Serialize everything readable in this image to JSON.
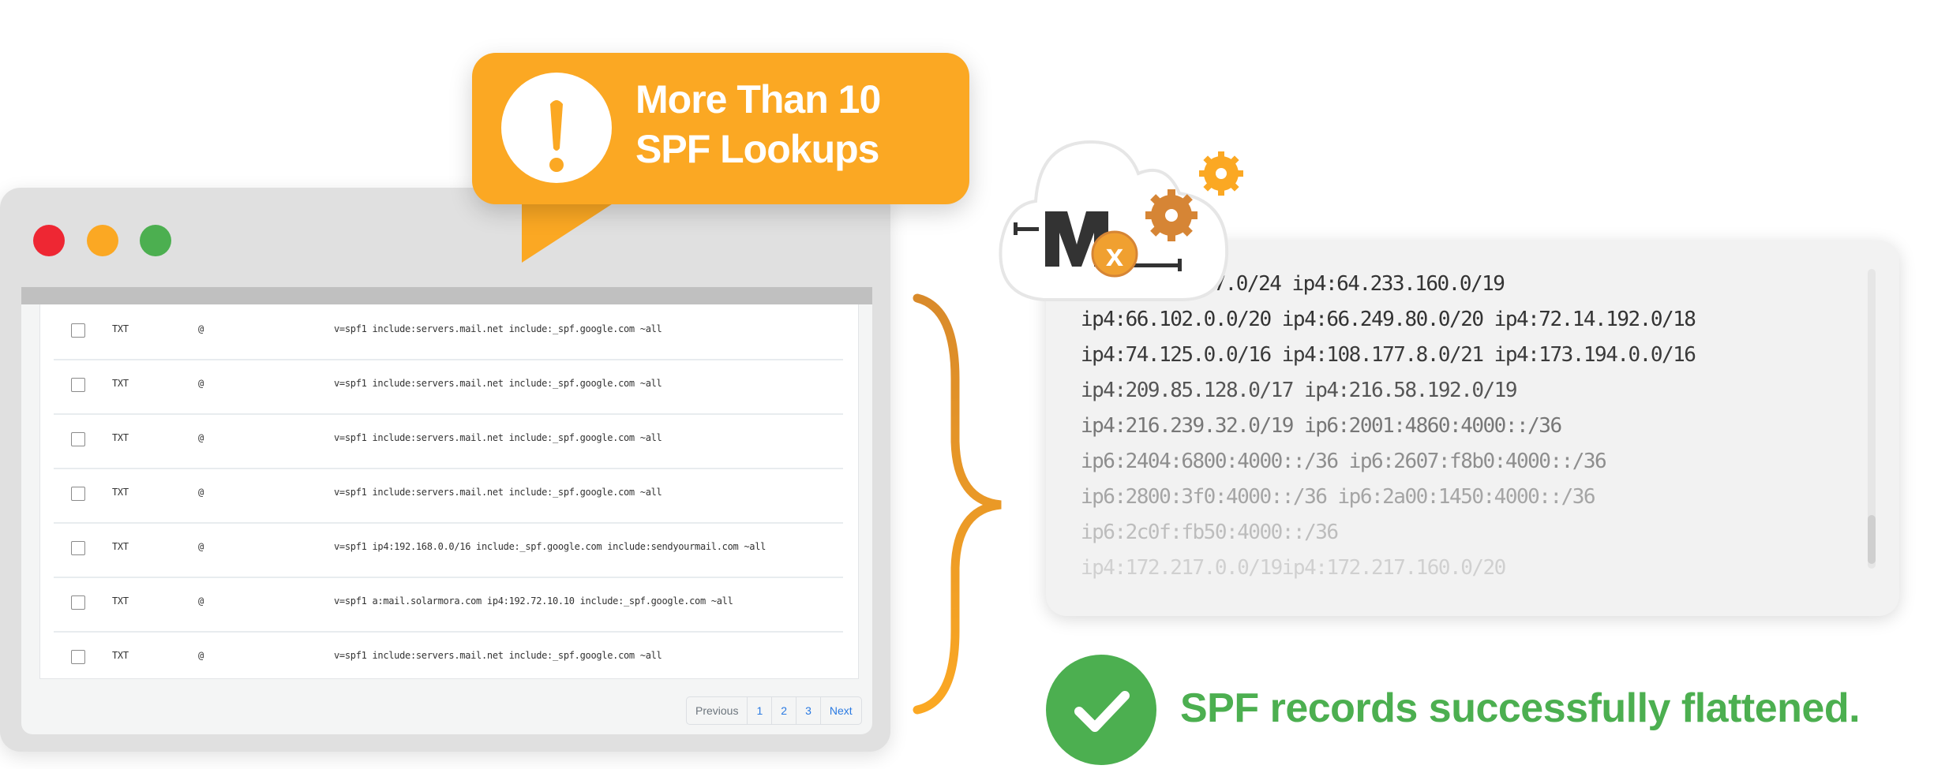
{
  "colors": {
    "accent_orange": "#fba823",
    "success_green": "#4caf50",
    "window_gray": "#e0e0e0",
    "link_blue": "#2a7ae2"
  },
  "window": {
    "traffic_lights": [
      "#ee2733",
      "#fba823",
      "#4caf50"
    ]
  },
  "records": [
    {
      "type": "TXT",
      "host": "@",
      "value": "v=spf1 include:servers.mail.net include:_spf.google.com ~all"
    },
    {
      "type": "TXT",
      "host": "@",
      "value": "v=spf1 include:servers.mail.net include:_spf.google.com ~all"
    },
    {
      "type": "TXT",
      "host": "@",
      "value": "v=spf1 include:servers.mail.net include:_spf.google.com ~all"
    },
    {
      "type": "TXT",
      "host": "@",
      "value": "v=spf1 include:servers.mail.net include:_spf.google.com ~all"
    },
    {
      "type": "TXT",
      "host": "@",
      "value": "v=spf1 ip4:192.168.0.0/16 include:_spf.google.com include:sendyourmail.com ~all"
    },
    {
      "type": "TXT",
      "host": "@",
      "value": "v=spf1 a:mail.solarmora.com ip4:192.72.10.10 include:_spf.google.com ~all"
    },
    {
      "type": "TXT",
      "host": "@",
      "value": "v=spf1 include:servers.mail.net include:_spf.google.com ~all"
    }
  ],
  "pagination": {
    "previous": "Previous",
    "pages": [
      "1",
      "2",
      "3"
    ],
    "next": "Next"
  },
  "callout": {
    "icon": "exclamation-icon",
    "line1": "More Than 10",
    "line2": "SPF Lookups"
  },
  "logo": {
    "text": "Mx",
    "icon": "cloud-gears-logo"
  },
  "flattened_lines": [
    ".247.0/24 ip4:64.233.160.0/19",
    "ip4:66.102.0.0/20 ip4:66.249.80.0/20 ip4:72.14.192.0/18",
    "ip4:74.125.0.0/16 ip4:108.177.8.0/21 ip4:173.194.0.0/16",
    "ip4:209.85.128.0/17 ip4:216.58.192.0/19",
    "ip4:216.239.32.0/19 ip6:2001:4860:4000::/36",
    "ip6:2404:6800:4000::/36 ip6:2607:f8b0:4000::/36",
    "ip6:2800:3f0:4000::/36 ip6:2a00:1450:4000::/36",
    "ip6:2c0f:fb50:4000::/36",
    "ip4:172.217.0.0/19ip4:172.217.160.0/20"
  ],
  "success": {
    "icon": "checkmark-icon",
    "message": "SPF records successfully flattened."
  }
}
